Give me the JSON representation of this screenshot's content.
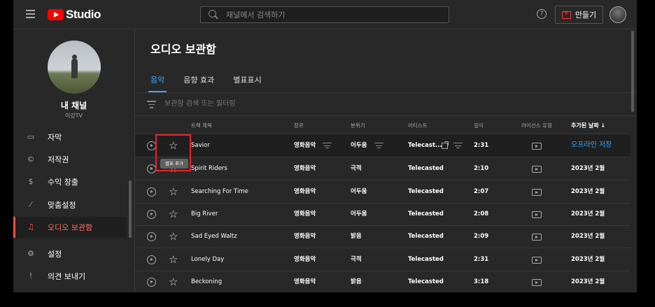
{
  "header": {
    "logo_text": "Studio",
    "search_placeholder": "채널에서 검색하기",
    "help_glyph": "?",
    "create_label": "만들기"
  },
  "sidebar": {
    "channel_name": "내 채널",
    "channel_sub": "이강TV",
    "items": [
      {
        "label": "자막",
        "icon": "subtitles-icon"
      },
      {
        "label": "저작권",
        "icon": "copyright-icon"
      },
      {
        "label": "수익 창출",
        "icon": "dollar-icon"
      },
      {
        "label": "맞춤설정",
        "icon": "magic-wand-icon"
      },
      {
        "label": "오디오 보관함",
        "icon": "audio-library-icon",
        "active": true
      },
      {
        "label": "설정",
        "icon": "gear-icon"
      },
      {
        "label": "의견 보내기",
        "icon": "feedback-icon"
      }
    ]
  },
  "main": {
    "title": "오디오 보관함",
    "tabs": [
      "음악",
      "음향 효과",
      "별표표시"
    ],
    "active_tab": "음악",
    "filter_placeholder": "보관함 검색 또는 필터링",
    "columns": {
      "track": "트랙 제목",
      "genre": "장르",
      "mood": "분위기",
      "artist": "아티스트",
      "duration": "길이",
      "license": "라이선스 유형",
      "added": "추가된 날짜 ↓"
    },
    "tooltip": "별표 추가",
    "rows": [
      {
        "title": "Savior",
        "genre": "영화음악",
        "mood": "어두움",
        "artist": "Telecast...",
        "duration": "2:31",
        "added": "오프라인 저장"
      },
      {
        "title": "Spirit Riders",
        "genre": "영화음악",
        "mood": "극적",
        "artist": "Telecasted",
        "duration": "2:10",
        "added": "2023년 2월"
      },
      {
        "title": "Searching For Time",
        "genre": "영화음악",
        "mood": "어두움",
        "artist": "Telecasted",
        "duration": "2:07",
        "added": "2023년 2월"
      },
      {
        "title": "Big River",
        "genre": "영화음악",
        "mood": "어두움",
        "artist": "Telecasted",
        "duration": "2:08",
        "added": "2023년 2월"
      },
      {
        "title": "Sad Eyed Waltz",
        "genre": "영화음악",
        "mood": "밝음",
        "artist": "Telecasted",
        "duration": "2:09",
        "added": "2023년 2월"
      },
      {
        "title": "Lonely Day",
        "genre": "영화음악",
        "mood": "극적",
        "artist": "Telecasted",
        "duration": "2:31",
        "added": "2023년 2월"
      },
      {
        "title": "Beckoning",
        "genre": "영화음악",
        "mood": "밝음",
        "artist": "Telecasted",
        "duration": "3:18",
        "added": "2023년 2월"
      }
    ]
  },
  "colors": {
    "accent_blue": "#3ea6ff",
    "active_red": "#ff4e45",
    "highlight_box": "#e3262c",
    "background": "#282828"
  }
}
